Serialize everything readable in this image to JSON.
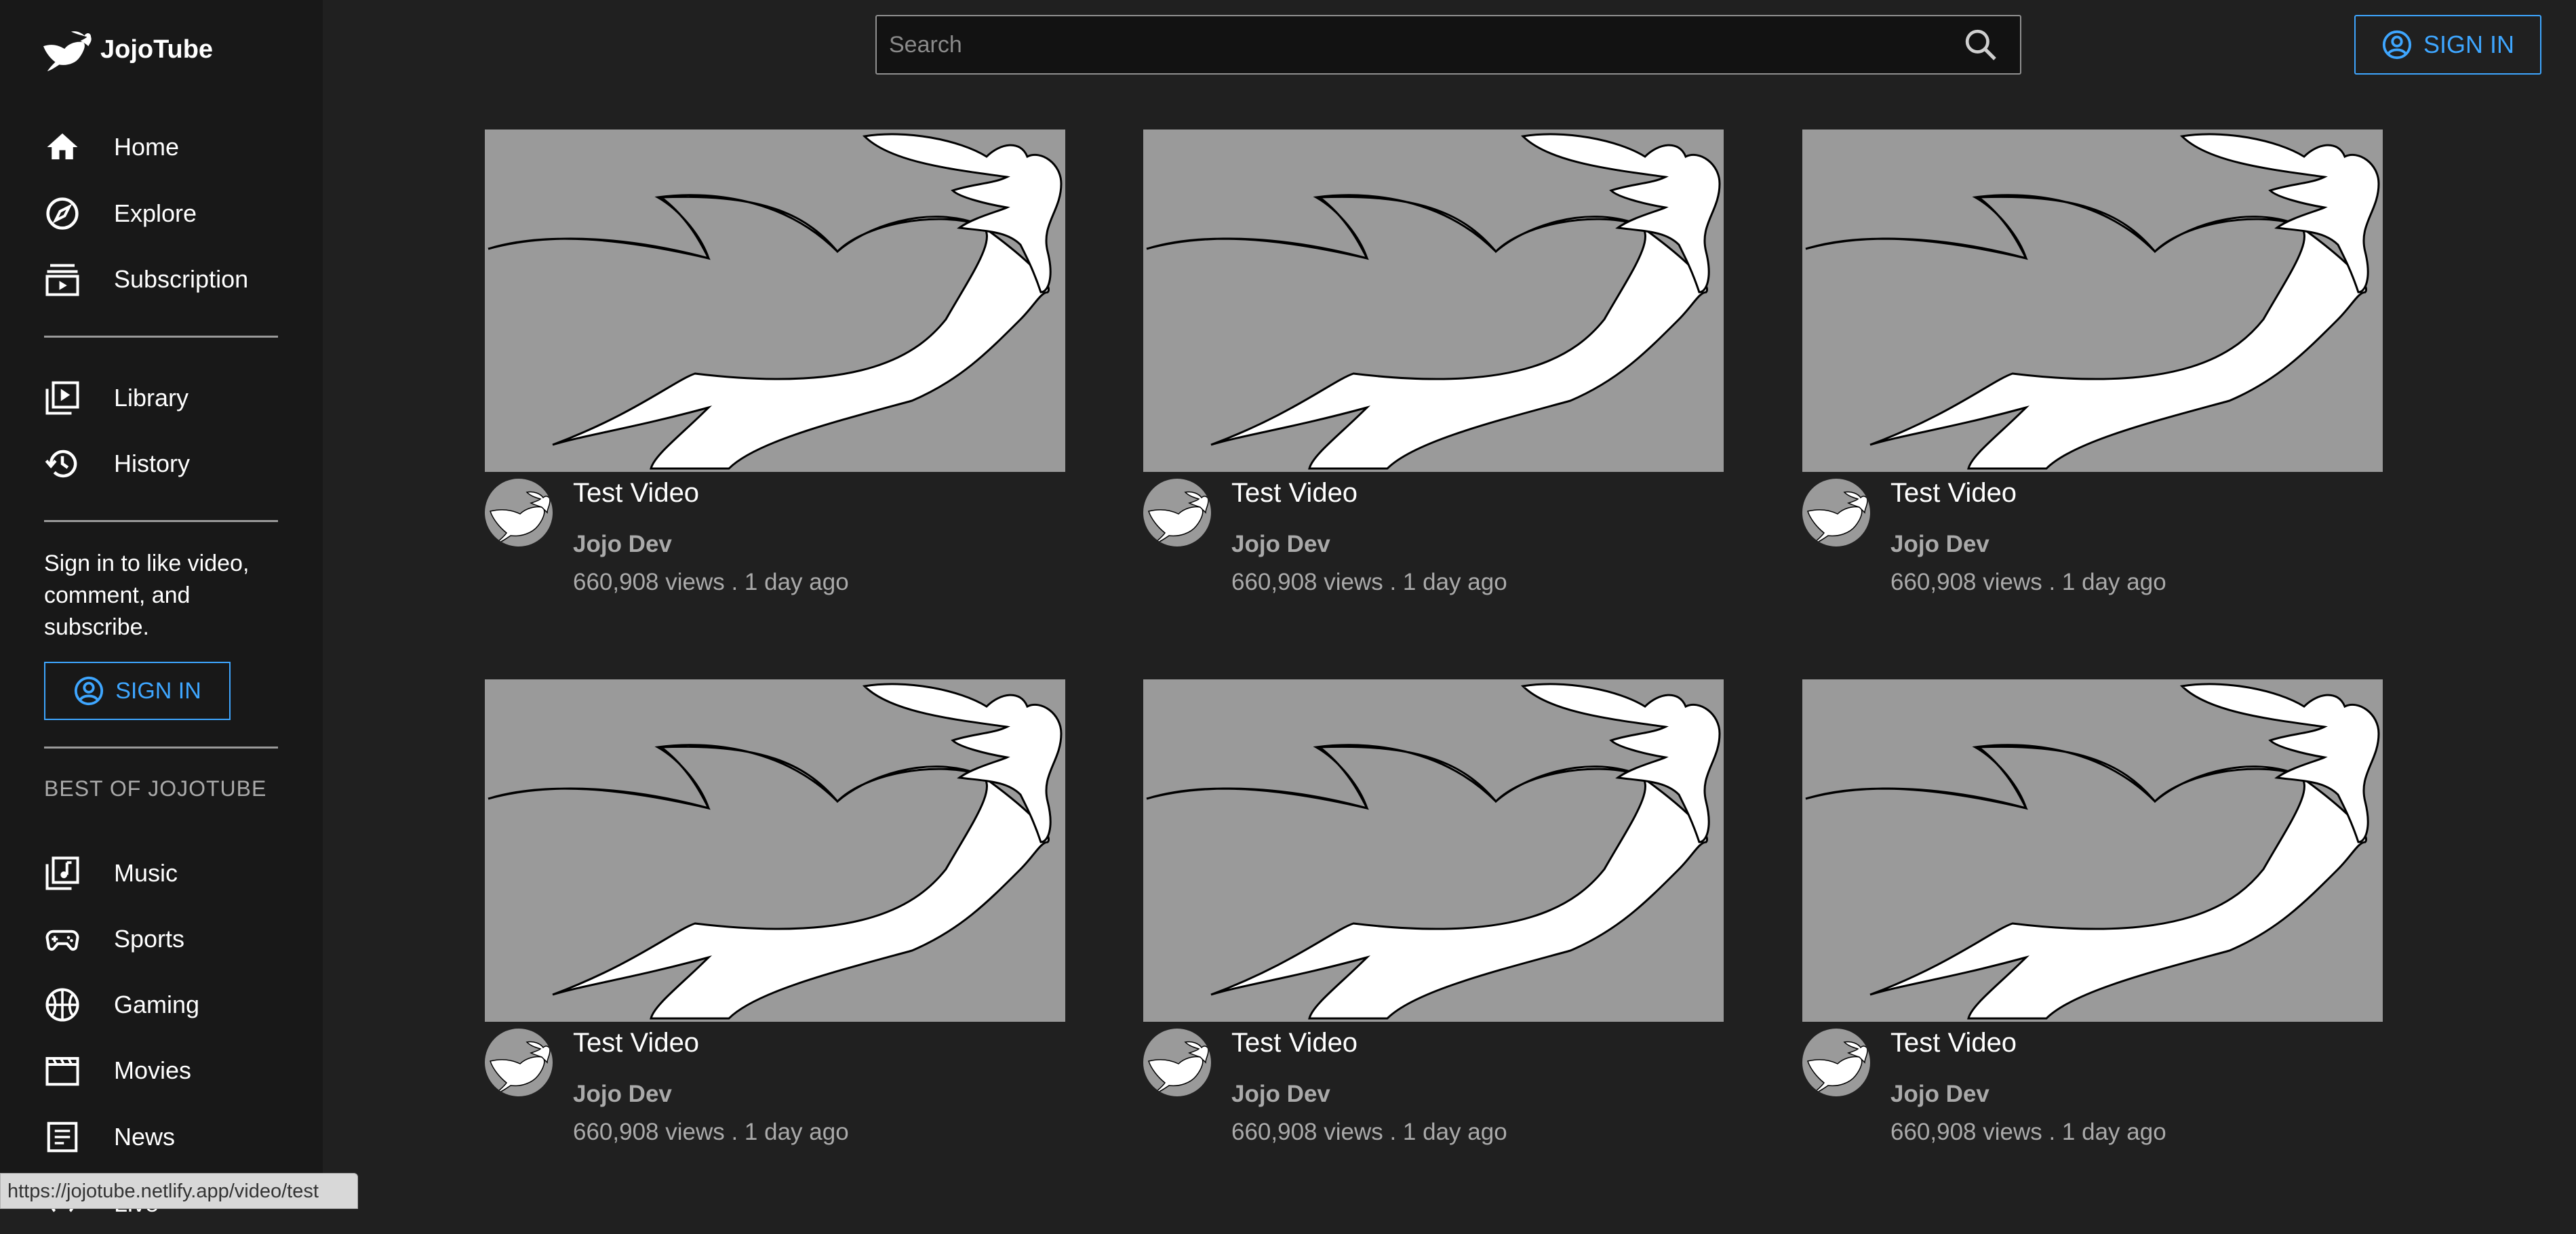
{
  "app": {
    "name": "JojoTube"
  },
  "header": {
    "search_placeholder": "Search",
    "signin_label": "SIGN IN"
  },
  "sidebar": {
    "main_items": [
      {
        "label": "Home",
        "icon": "home-icon"
      },
      {
        "label": "Explore",
        "icon": "compass-icon"
      },
      {
        "label": "Subscription",
        "icon": "subscriptions-icon"
      }
    ],
    "library_items": [
      {
        "label": "Library",
        "icon": "video-library-icon"
      },
      {
        "label": "History",
        "icon": "history-icon"
      }
    ],
    "signin_prompt": "Sign in to like video, comment, and subscribe.",
    "signin_label": "SIGN IN",
    "best_of_title": "BEST OF JOJOTUBE",
    "best_of_items": [
      {
        "label": "Music",
        "icon": "music-library-icon"
      },
      {
        "label": "Sports",
        "icon": "gamepad-icon"
      },
      {
        "label": "Gaming",
        "icon": "basketball-icon"
      },
      {
        "label": "Movies",
        "icon": "clapperboard-icon"
      },
      {
        "label": "News",
        "icon": "newspaper-icon"
      },
      {
        "label": "Live",
        "icon": "live-icon"
      }
    ]
  },
  "videos": [
    {
      "title": "Test Video",
      "channel": "Jojo Dev",
      "meta": "660,908 views . 1 day ago"
    },
    {
      "title": "Test Video",
      "channel": "Jojo Dev",
      "meta": "660,908 views . 1 day ago"
    },
    {
      "title": "Test Video",
      "channel": "Jojo Dev",
      "meta": "660,908 views . 1 day ago"
    },
    {
      "title": "Test Video",
      "channel": "Jojo Dev",
      "meta": "660,908 views . 1 day ago"
    },
    {
      "title": "Test Video",
      "channel": "Jojo Dev",
      "meta": "660,908 views . 1 day ago"
    },
    {
      "title": "Test Video",
      "channel": "Jojo Dev",
      "meta": "660,908 views . 1 day ago"
    }
  ],
  "status_url": "https://jojotube.netlify.app/video/test",
  "colors": {
    "background": "#202020",
    "sidebar": "#181818",
    "accent": "#3ea6ff",
    "secondary_text": "#aaaaaa",
    "thumbnail_bg": "#9a9a9a"
  }
}
